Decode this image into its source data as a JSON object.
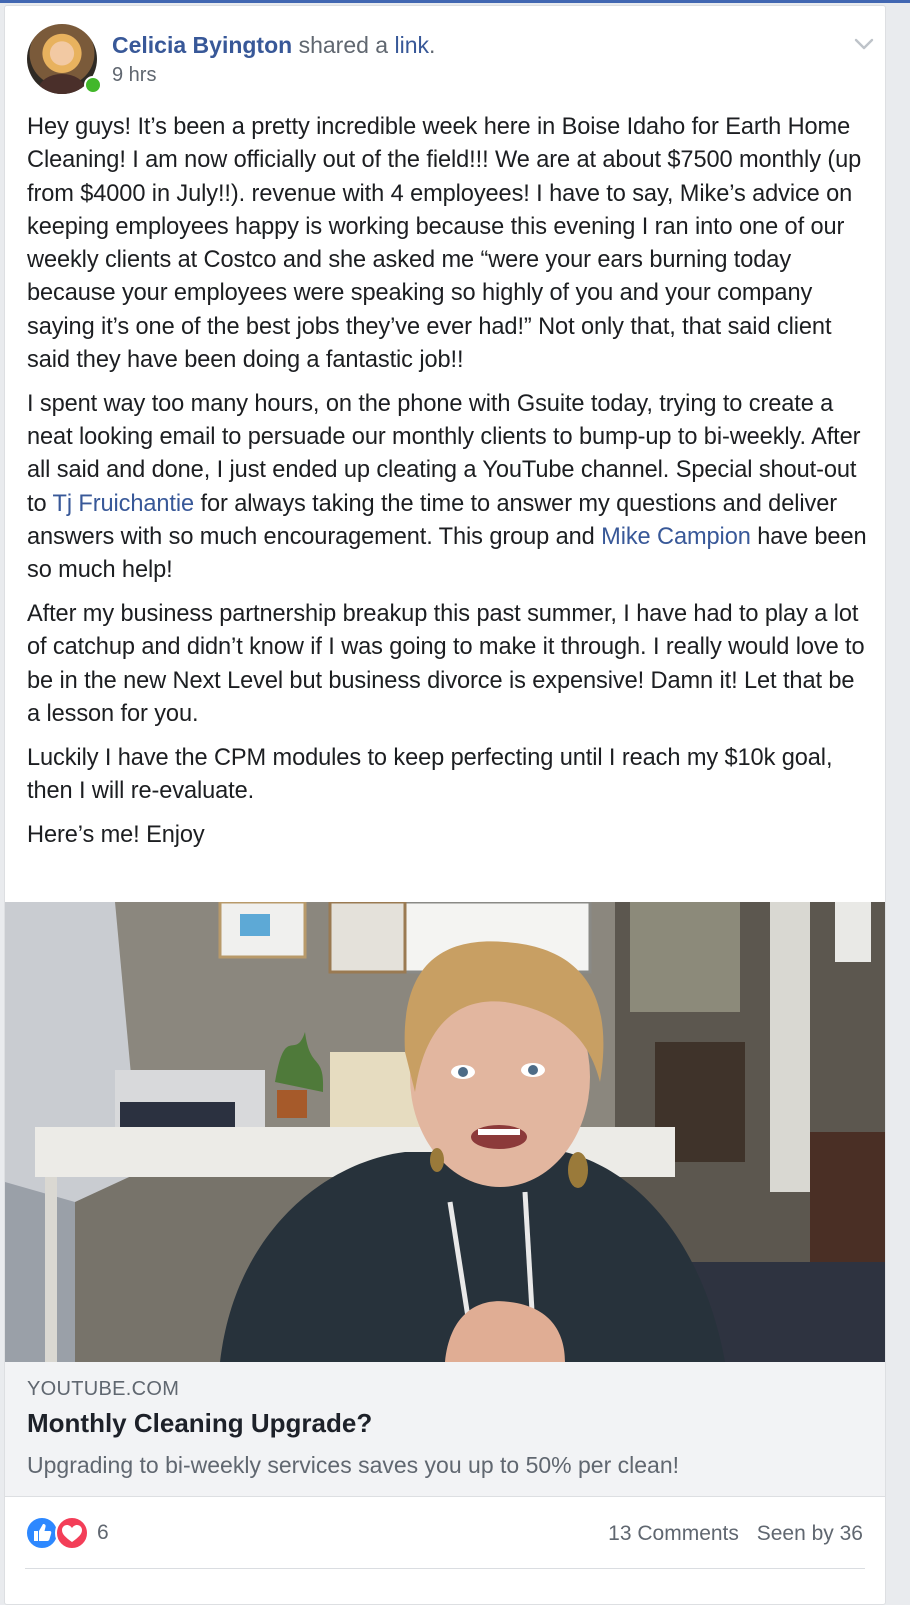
{
  "post": {
    "author": "Celicia Byington",
    "action_text": "shared a",
    "action_link": "link",
    "action_suffix": ".",
    "time": "9 hrs",
    "paragraphs": [
      {
        "text": "Hey guys! It’s been a pretty incredible week here in Boise Idaho for Earth Home Cleaning! I am now officially out of the field!!! We are at about $7500 monthly (up from $4000 in July!!). revenue with 4 employees! I have to say, Mike’s advice on keeping employees happy is working because this evening I ran into one of our weekly clients at Costco and she asked me “were your ears burning today because your employees were speaking so highly of you and your company saying it’s one of the best jobs they’ve ever had!” Not only that, that said client said they have been doing a fantastic job!!"
      },
      {
        "part1": "I spent way too many hours, on the phone with Gsuite today, trying to create a neat looking email to persuade our monthly clients to bump-up to bi-weekly. After all said and done, I just ended up cleating a YouTube channel. Special shout-out to ",
        "mention1": "Tj Fruichantie",
        "part2": " for always taking the time to answer my questions and deliver answers with so much encouragement. This group and ",
        "mention2": "Mike Campion",
        "part3": " have been so much help!"
      },
      {
        "text": "After my business partnership breakup this past summer, I have had to play a lot of catchup and didn’t know if I was going to make it through. I really would love to be in the new Next Level but business divorce is expensive! Damn it! Let that be a lesson for you."
      },
      {
        "text": "Luckily I have the CPM modules to keep perfecting until I reach my $10k goal, then I will re-evaluate."
      },
      {
        "text": "Here’s me! Enjoy"
      }
    ]
  },
  "link_preview": {
    "domain": "YOUTUBE.COM",
    "title": "Monthly Cleaning Upgrade?",
    "description": "Upgrading to bi-weekly services saves you up to 50% per clean!"
  },
  "footer": {
    "reaction_count": "6",
    "comments": "13 Comments",
    "seen_by": "Seen by 36"
  },
  "colors": {
    "link_blue": "#385898",
    "like_blue": "#2d88ff",
    "love_red": "#f33e58",
    "online_green": "#42b72a"
  },
  "icons": [
    "chevron-down-icon",
    "like-reaction-icon",
    "love-reaction-icon",
    "online-status-icon"
  ]
}
